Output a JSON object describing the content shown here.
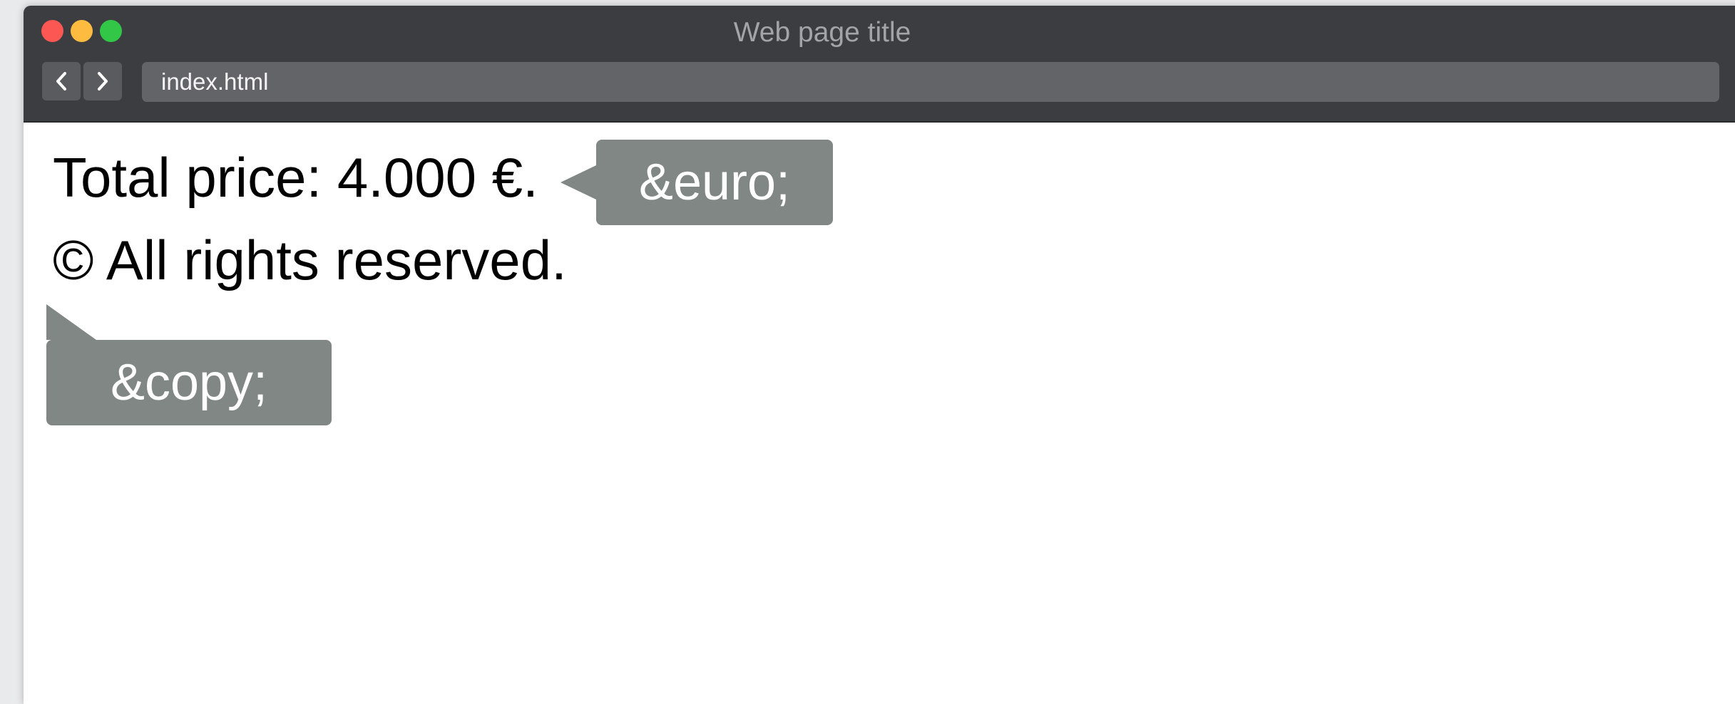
{
  "window": {
    "title": "Web page title",
    "address": "index.html",
    "colors": {
      "close": "#fc5753",
      "minimize": "#fdbc40",
      "maximize": "#33c748",
      "chrome": "#3c3d41",
      "callout": "#818784"
    }
  },
  "nav": {
    "back_icon": "chevron-left-icon",
    "forward_icon": "chevron-right-icon"
  },
  "content": {
    "line1": "Total price: 4.000 €.",
    "line2": "© All rights reserved.",
    "callout_euro": "&euro;",
    "callout_copy": "&copy;"
  }
}
